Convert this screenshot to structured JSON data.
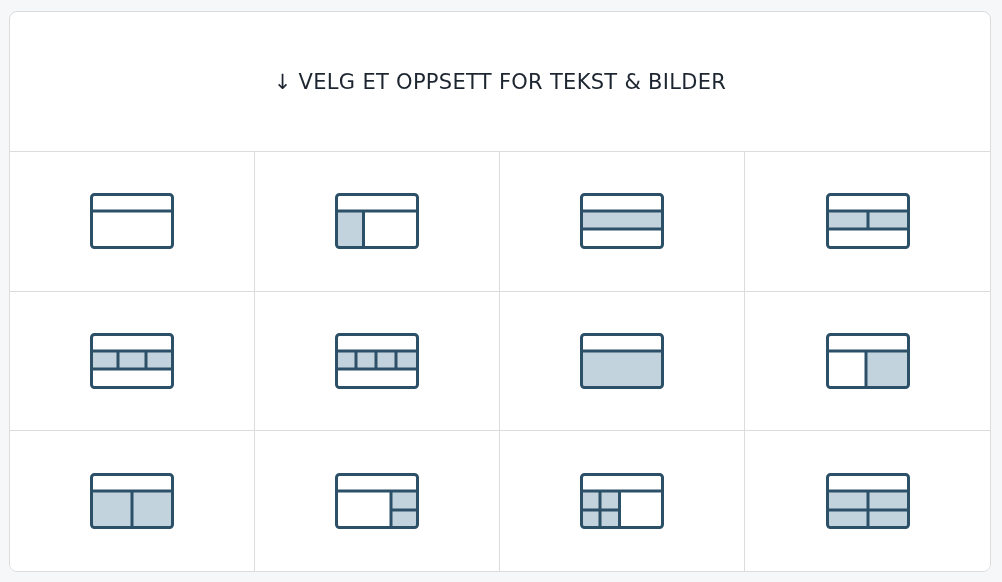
{
  "header": {
    "title": "↓ VELG ET OPPSETT FOR TEKST & BILDER"
  },
  "layouts": [
    {
      "kind": "single"
    },
    {
      "kind": "sidebar-left"
    },
    {
      "kind": "band"
    },
    {
      "kind": "band-two"
    },
    {
      "kind": "band-three"
    },
    {
      "kind": "band-four"
    },
    {
      "kind": "full"
    },
    {
      "kind": "split-right"
    },
    {
      "kind": "two-columns"
    },
    {
      "kind": "right-stack"
    },
    {
      "kind": "grid-left"
    },
    {
      "kind": "two-by-two"
    }
  ]
}
